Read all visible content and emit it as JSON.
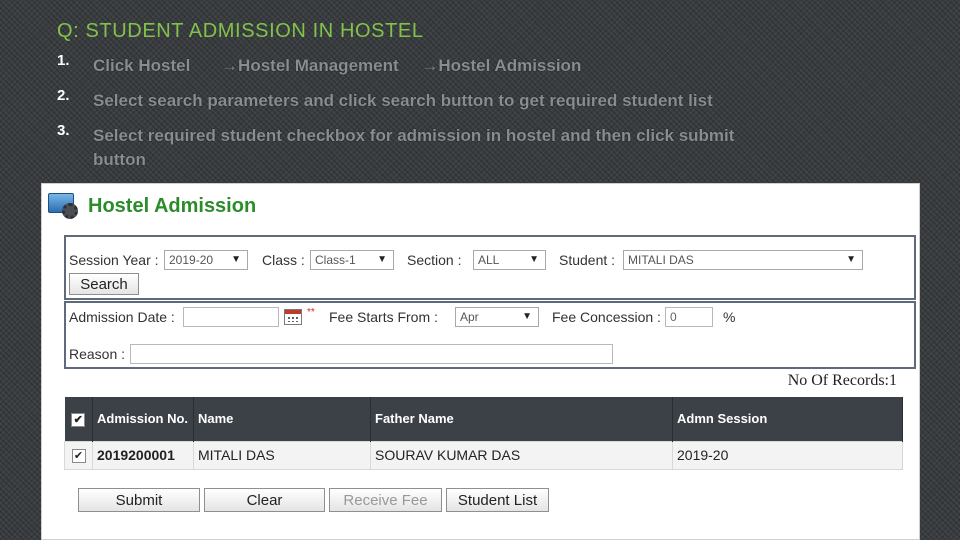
{
  "slide": {
    "title": "Q: STUDENT ADMISSION IN HOSTEL",
    "steps": [
      {
        "num": "1.",
        "parts": [
          "Click Hostel",
          "→Hostel Management",
          "→Hostel Admission"
        ]
      },
      {
        "num": "2.",
        "text": "Select search parameters and click search button to get required student list"
      },
      {
        "num": "3.",
        "line1": "Select required student checkbox for admission in hostel and then click submit",
        "line2": "button"
      }
    ]
  },
  "app": {
    "title": "Hostel Admission",
    "icon": "monitor-gear-icon",
    "search": {
      "session_year_label": "Session Year :",
      "session_year_value": "2019-20",
      "class_label": "Class :",
      "class_value": "Class-1",
      "section_label": "Section :",
      "section_value": "ALL",
      "student_label": "Student :",
      "student_value": "MITALI DAS",
      "search_button": "Search"
    },
    "admission": {
      "date_label": "Admission Date :",
      "date_value": "",
      "required_mark": "**",
      "fee_starts_label": "Fee Starts From :",
      "fee_starts_value": "Apr",
      "fee_concession_label": "Fee Concession :",
      "fee_concession_value": "0",
      "percent": "%",
      "reason_label": "Reason :",
      "reason_value": ""
    },
    "records_label": "No Of Records:1",
    "table": {
      "headers": [
        "Admission No.",
        "Name",
        "Father Name",
        "Admn Session"
      ],
      "rows": [
        {
          "checked": "✔",
          "admission_no": "2019200001",
          "name": "MITALI DAS",
          "father_name": "SOURAV KUMAR DAS",
          "session": "2019-20"
        }
      ],
      "header_check": "✔"
    },
    "buttons": {
      "submit": "Submit",
      "clear": "Clear",
      "receive_fee": "Receive Fee",
      "student_list": "Student List"
    }
  },
  "colors": {
    "title_green": "#82c24a",
    "app_title_green": "#2c8c2c",
    "table_header": "#3c4047"
  }
}
